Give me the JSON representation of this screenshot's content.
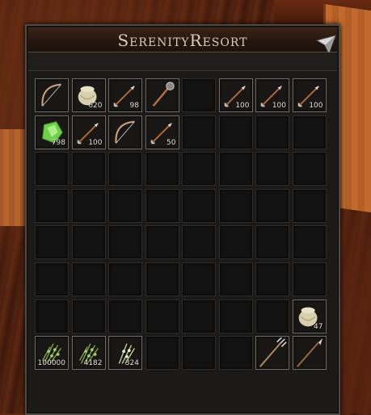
{
  "window": {
    "title": "SerenityResort"
  },
  "inventory": {
    "rows": [
      [
        {
          "item": "bow",
          "qty": ""
        },
        {
          "item": "pouch",
          "qty": "620"
        },
        {
          "item": "arrow",
          "qty": "98"
        },
        {
          "item": "mace",
          "qty": ""
        },
        {
          "item": "",
          "qty": ""
        },
        {
          "item": "arrow",
          "qty": "100"
        },
        {
          "item": "arrow",
          "qty": "100"
        },
        {
          "item": "arrow",
          "qty": "100"
        }
      ],
      [
        {
          "item": "gem",
          "qty": "798"
        },
        {
          "item": "arrow",
          "qty": "100"
        },
        {
          "item": "bow",
          "qty": ""
        },
        {
          "item": "arrow",
          "qty": "50"
        },
        {
          "item": "",
          "qty": ""
        },
        {
          "item": "",
          "qty": ""
        },
        {
          "item": "",
          "qty": ""
        },
        {
          "item": "",
          "qty": ""
        }
      ],
      [
        {
          "item": "",
          "qty": ""
        },
        {
          "item": "",
          "qty": ""
        },
        {
          "item": "",
          "qty": ""
        },
        {
          "item": "",
          "qty": ""
        },
        {
          "item": "",
          "qty": ""
        },
        {
          "item": "",
          "qty": ""
        },
        {
          "item": "",
          "qty": ""
        },
        {
          "item": "",
          "qty": ""
        }
      ],
      [
        {
          "item": "",
          "qty": ""
        },
        {
          "item": "",
          "qty": ""
        },
        {
          "item": "",
          "qty": ""
        },
        {
          "item": "",
          "qty": ""
        },
        {
          "item": "",
          "qty": ""
        },
        {
          "item": "",
          "qty": ""
        },
        {
          "item": "",
          "qty": ""
        },
        {
          "item": "",
          "qty": ""
        }
      ],
      [
        {
          "item": "",
          "qty": ""
        },
        {
          "item": "",
          "qty": ""
        },
        {
          "item": "",
          "qty": ""
        },
        {
          "item": "",
          "qty": ""
        },
        {
          "item": "",
          "qty": ""
        },
        {
          "item": "",
          "qty": ""
        },
        {
          "item": "",
          "qty": ""
        },
        {
          "item": "",
          "qty": ""
        }
      ],
      [
        {
          "item": "",
          "qty": ""
        },
        {
          "item": "",
          "qty": ""
        },
        {
          "item": "",
          "qty": ""
        },
        {
          "item": "",
          "qty": ""
        },
        {
          "item": "",
          "qty": ""
        },
        {
          "item": "",
          "qty": ""
        },
        {
          "item": "",
          "qty": ""
        },
        {
          "item": "",
          "qty": ""
        }
      ],
      [
        {
          "item": "",
          "qty": ""
        },
        {
          "item": "",
          "qty": ""
        },
        {
          "item": "",
          "qty": ""
        },
        {
          "item": "",
          "qty": ""
        },
        {
          "item": "",
          "qty": ""
        },
        {
          "item": "",
          "qty": ""
        },
        {
          "item": "",
          "qty": ""
        },
        {
          "item": "pouch",
          "qty": "47"
        }
      ],
      [
        {
          "item": "herb",
          "qty": "100000"
        },
        {
          "item": "herb",
          "qty": "4182"
        },
        {
          "item": "herb-light",
          "qty": "324"
        },
        {
          "item": "",
          "qty": ""
        },
        {
          "item": "",
          "qty": ""
        },
        {
          "item": "",
          "qty": ""
        },
        {
          "item": "trident",
          "qty": ""
        },
        {
          "item": "spear",
          "qty": ""
        }
      ]
    ]
  },
  "icons": {
    "pin": "pin-icon"
  }
}
